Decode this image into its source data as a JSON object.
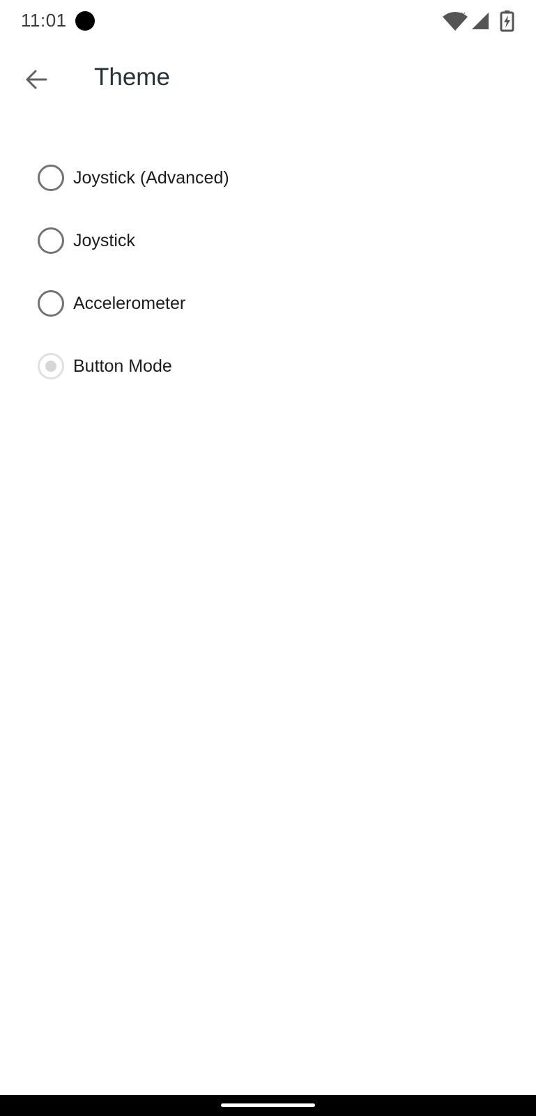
{
  "status_bar": {
    "time": "11:01",
    "icons": [
      "wifi-icon",
      "signal-icon",
      "battery-charging-icon"
    ]
  },
  "app_bar": {
    "back_icon": "arrow-back-icon",
    "title": "Theme"
  },
  "theme_options": [
    {
      "label": "Joystick (Advanced)",
      "selected": false
    },
    {
      "label": "Joystick",
      "selected": false
    },
    {
      "label": "Accelerometer",
      "selected": false
    },
    {
      "label": "Button Mode",
      "selected": true
    }
  ],
  "colors": {
    "title": "#263238",
    "radio_border": "#737373",
    "radio_selected_disabled": "#d6d6d6",
    "nav_bar": "#000000"
  }
}
